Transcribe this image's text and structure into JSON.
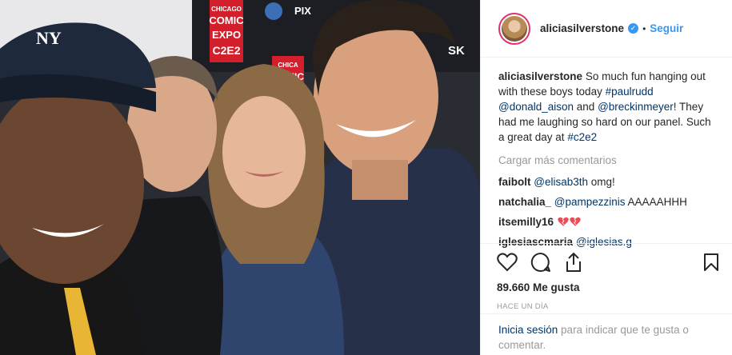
{
  "post": {
    "username": "aliciasilverstone",
    "verified_icon": "verified-badge-icon",
    "separator": "•",
    "follow_label": "Seguir",
    "caption_user": "aliciasilverstone",
    "caption_parts": {
      "t1": "So much fun hanging out with these boys today ",
      "h1": "#paulrudd",
      "sp1": " ",
      "m1": "@donald_aison",
      "t2": " and ",
      "m2": "@breckinmeyer",
      "t3": "! They had me laughing so hard on our panel. Such a great day at ",
      "h2": "#c2e2"
    },
    "load_more": "Cargar más comentarios",
    "comments": [
      {
        "user": "faibolt",
        "mention": "@elisab3th",
        "text": " omg!"
      },
      {
        "user": "natchalia_",
        "mention": "@pampezzinis",
        "text": " AAAAAHHH"
      },
      {
        "user": "itsemilly16",
        "mention": "",
        "text": ""
      },
      {
        "user": "iglesiascmaria",
        "mention": "@iglesias.g",
        "text": ""
      }
    ],
    "likes": "89.660 Me gusta",
    "time_ago": "HACE UN DÍA",
    "login_link": "Inicia sesión",
    "login_text": " para indicar que te gusta o comentar."
  },
  "photo": {
    "backdrop_texts": [
      "CHICAGO",
      "COMIC",
      "EXPO",
      "C2E2",
      "CHICA",
      "COMIC",
      "PIX",
      "SK"
    ]
  },
  "colors": {
    "link": "#003569",
    "follow": "#3897f0",
    "muted": "#999999",
    "heart": "#ed4956"
  }
}
